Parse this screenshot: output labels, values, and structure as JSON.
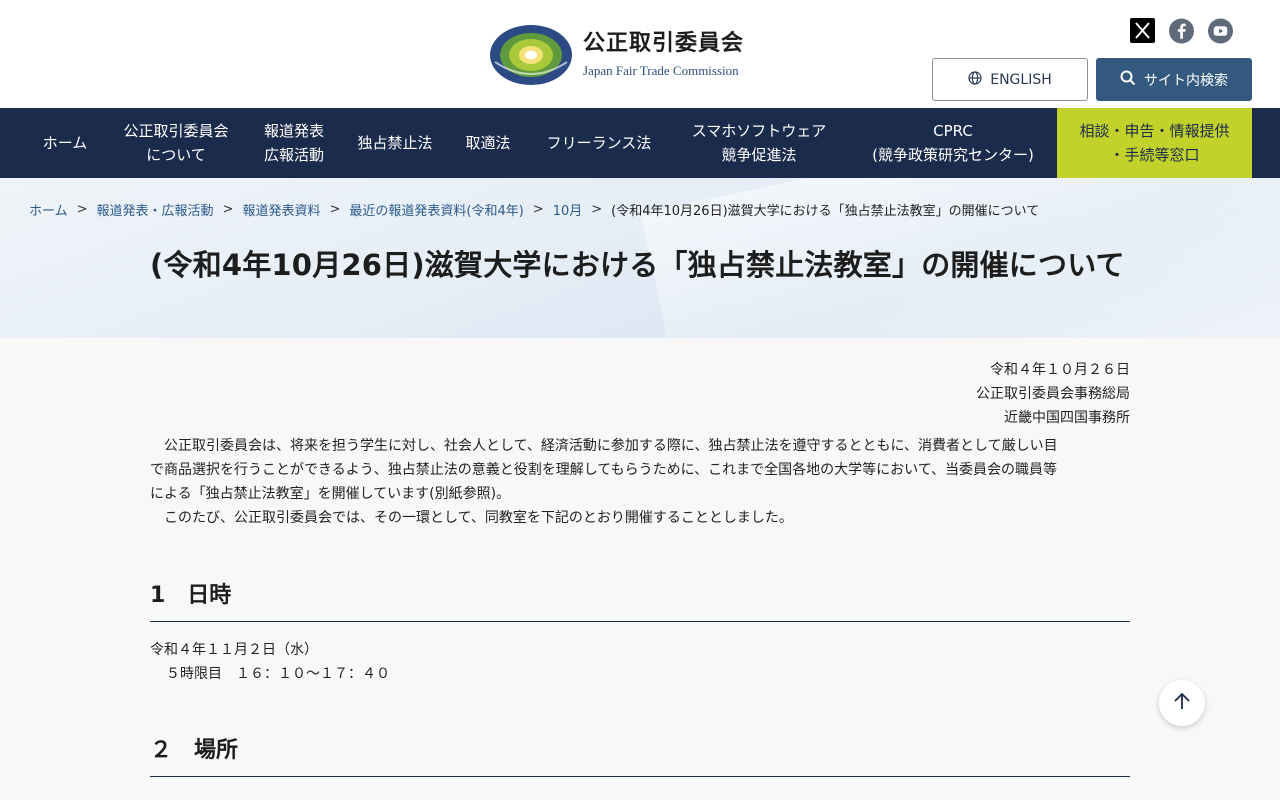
{
  "header": {
    "org_name_ja": "公正取引委員会",
    "org_name_en": "Japan Fair Trade Commission",
    "emblem_ring_text": "JAPAN FAIR TRADE COMMISSION",
    "social": [
      {
        "name": "x-icon"
      },
      {
        "name": "facebook-icon"
      },
      {
        "name": "youtube-icon"
      }
    ],
    "english_label": "ENGLISH",
    "search_label": "サイト内検索"
  },
  "nav": {
    "items": [
      "ホーム",
      "公正取引委員会\nについて",
      "報道発表\n広報活動",
      "独占禁止法",
      "取適法",
      "フリーランス法",
      "スマホソフトウェア\n競争促進法",
      "CPRC\n(競争政策研究センター)"
    ],
    "consult": "相談・申告・情報提供\n・手続等窓口"
  },
  "breadcrumb": {
    "items": [
      "ホーム",
      "報道発表・広報活動",
      "報道発表資料",
      "最近の報道発表資料(令和4年)",
      "10月"
    ],
    "current": "(令和4年10月26日)滋賀大学における「独占禁止法教室」の開催について",
    "separator": ">"
  },
  "page": {
    "title": "(令和4年10月26日)滋賀大学における「独占禁止法教室」の開催について",
    "date": "令和４年１０月２６日",
    "issuer1": "公正取引委員会事務総局",
    "issuer2": "近畿中国四国事務所",
    "para1_line1": "公正取引委員会は、将来を担う学生に対し、社会人として、経済活動に参加する際に、独占禁止法を遵守するとともに、消費者として厳しい目",
    "para1_line2": "で商品選択を行うことができるよう、独占禁止法の意義と役割を理解してもらうために、これまで全国各地の大学等において、当委員会の職員等",
    "para1_line3": "による「独占禁止法教室」を開催しています(別紙参照)。",
    "para2": "このたび、公正取引委員会では、その一環として、同教室を下記のとおり開催することとしました。",
    "section1_heading": "1　日時",
    "section1_date": "令和４年１１月２日（水）",
    "section1_time": "５時限目　１６：１０～１７：４０",
    "section2_heading": "２　場所"
  },
  "colors": {
    "nav_bg": "#1b2b4b",
    "consult_bg": "#c2d22a",
    "search_btn": "#34597f",
    "link": "#2a5a8c"
  }
}
